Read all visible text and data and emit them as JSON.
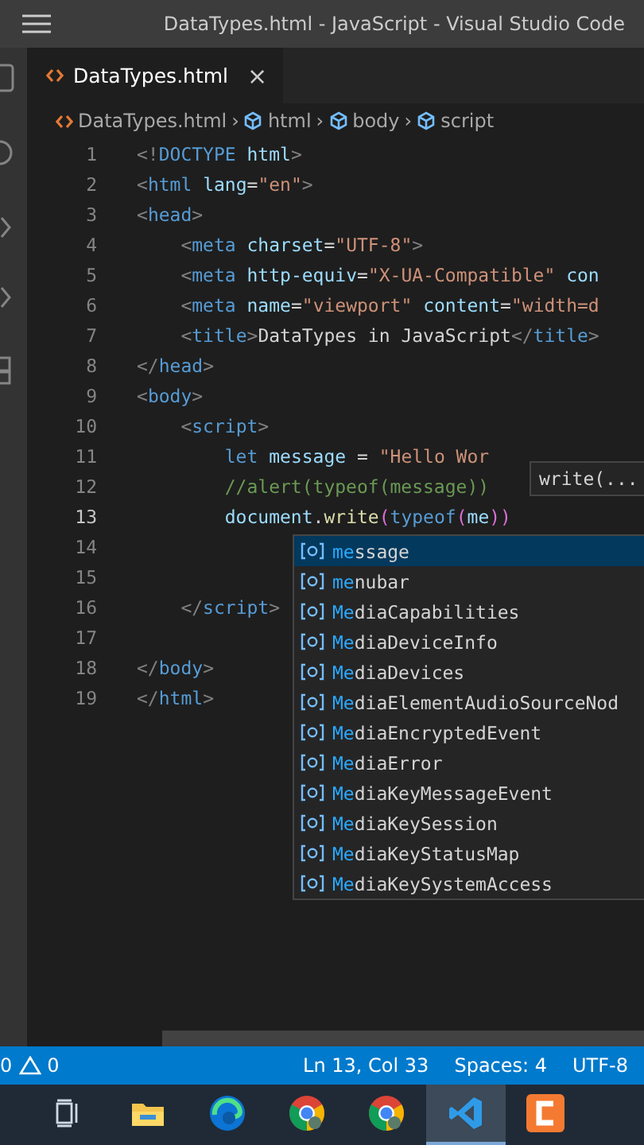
{
  "title_bar": {
    "title": "DataTypes.html - JavaScript - Visual Studio Code"
  },
  "tabs": [
    {
      "label": "DataTypes.html",
      "selected": true,
      "close": "×"
    }
  ],
  "breadcrumbs": [
    {
      "label": "DataTypes.html",
      "kind": "file"
    },
    {
      "separator": "›",
      "label": "html",
      "kind": "element"
    },
    {
      "separator": "›",
      "label": "body",
      "kind": "element"
    },
    {
      "separator": "›",
      "label": "script",
      "kind": "element"
    }
  ],
  "editor": {
    "lines": [
      {
        "number": "1",
        "current": false,
        "tokens": [
          {
            "kind": "punct",
            "text": "<!"
          },
          {
            "kind": "tag",
            "text": "DOCTYPE"
          },
          {
            "kind": "attr",
            "text": " html"
          },
          {
            "kind": "punct",
            "text": ">"
          }
        ]
      },
      {
        "number": "2",
        "current": false,
        "tokens": [
          {
            "kind": "punct",
            "text": "<"
          },
          {
            "kind": "tag",
            "text": "html"
          },
          {
            "kind": "attr",
            "text": " lang"
          },
          {
            "kind": "text",
            "text": "="
          },
          {
            "kind": "str",
            "text": "\"en\""
          },
          {
            "kind": "punct",
            "text": ">"
          }
        ]
      },
      {
        "number": "3",
        "current": false,
        "tokens": [
          {
            "kind": "punct",
            "text": "<"
          },
          {
            "kind": "tag",
            "text": "head"
          },
          {
            "kind": "punct",
            "text": ">"
          }
        ]
      },
      {
        "number": "4",
        "current": false,
        "tokens": [
          {
            "kind": "punct",
            "text": "    <"
          },
          {
            "kind": "tag",
            "text": "meta"
          },
          {
            "kind": "attr",
            "text": " charset"
          },
          {
            "kind": "text",
            "text": "="
          },
          {
            "kind": "str",
            "text": "\"UTF-8\""
          },
          {
            "kind": "punct",
            "text": ">"
          }
        ]
      },
      {
        "number": "5",
        "current": false,
        "tokens": [
          {
            "kind": "punct",
            "text": "    <"
          },
          {
            "kind": "tag",
            "text": "meta"
          },
          {
            "kind": "attr",
            "text": " http-equiv"
          },
          {
            "kind": "text",
            "text": "="
          },
          {
            "kind": "str",
            "text": "\"X-UA-Compatible\""
          },
          {
            "kind": "attr",
            "text": " con"
          }
        ]
      },
      {
        "number": "6",
        "current": false,
        "tokens": [
          {
            "kind": "punct",
            "text": "    <"
          },
          {
            "kind": "tag",
            "text": "meta"
          },
          {
            "kind": "attr",
            "text": " name"
          },
          {
            "kind": "text",
            "text": "="
          },
          {
            "kind": "str",
            "text": "\"viewport\""
          },
          {
            "kind": "attr",
            "text": " content"
          },
          {
            "kind": "text",
            "text": "="
          },
          {
            "kind": "str",
            "text": "\"width=d"
          }
        ]
      },
      {
        "number": "7",
        "current": false,
        "tokens": [
          {
            "kind": "punct",
            "text": "    <"
          },
          {
            "kind": "tag",
            "text": "title"
          },
          {
            "kind": "punct",
            "text": ">"
          },
          {
            "kind": "text",
            "text": "DataTypes in JavaScript"
          },
          {
            "kind": "punct",
            "text": "</"
          },
          {
            "kind": "tag",
            "text": "title"
          },
          {
            "kind": "punct",
            "text": ">"
          }
        ]
      },
      {
        "number": "8",
        "current": false,
        "tokens": [
          {
            "kind": "punct",
            "text": "</"
          },
          {
            "kind": "tag",
            "text": "head"
          },
          {
            "kind": "punct",
            "text": ">"
          }
        ]
      },
      {
        "number": "9",
        "current": false,
        "tokens": [
          {
            "kind": "punct",
            "text": "<"
          },
          {
            "kind": "tag",
            "text": "body"
          },
          {
            "kind": "punct",
            "text": ">"
          }
        ]
      },
      {
        "number": "10",
        "current": false,
        "tokens": [
          {
            "kind": "punct",
            "text": "    <"
          },
          {
            "kind": "tag",
            "text": "script"
          },
          {
            "kind": "punct",
            "text": ">"
          }
        ]
      },
      {
        "number": "11",
        "current": false,
        "tokens": [
          {
            "kind": "kw",
            "text": "        let"
          },
          {
            "kind": "var",
            "text": " message"
          },
          {
            "kind": "text",
            "text": " = "
          },
          {
            "kind": "str",
            "text": "\"Hello Wor"
          }
        ]
      },
      {
        "number": "12",
        "current": false,
        "tokens": [
          {
            "kind": "comment",
            "text": "        //alert(typeof(message))"
          }
        ]
      },
      {
        "number": "13",
        "current": true,
        "tokens": [
          {
            "kind": "var",
            "text": "        document"
          },
          {
            "kind": "text",
            "text": "."
          },
          {
            "kind": "fn",
            "text": "write"
          },
          {
            "kind": "paren",
            "text": "("
          },
          {
            "kind": "kw",
            "text": "typeof"
          },
          {
            "kind": "paren",
            "text": "("
          },
          {
            "kind": "var",
            "text": "me"
          },
          {
            "kind": "paren",
            "text": "))"
          }
        ]
      },
      {
        "number": "14",
        "current": false
      },
      {
        "number": "15",
        "current": false
      },
      {
        "number": "16",
        "current": false,
        "tokens": [
          {
            "kind": "punct",
            "text": "    </"
          },
          {
            "kind": "tag",
            "text": "script"
          },
          {
            "kind": "punct",
            "text": ">"
          }
        ]
      },
      {
        "number": "17",
        "current": false
      },
      {
        "number": "18",
        "current": false,
        "tokens": [
          {
            "kind": "punct",
            "text": "</"
          },
          {
            "kind": "tag",
            "text": "body"
          },
          {
            "kind": "punct",
            "text": ">"
          }
        ]
      },
      {
        "number": "19",
        "current": false,
        "tokens": [
          {
            "kind": "punct",
            "text": "</"
          },
          {
            "kind": "tag",
            "text": "html"
          },
          {
            "kind": "punct",
            "text": ">"
          }
        ]
      }
    ]
  },
  "hover": {
    "text": "write(..."
  },
  "suggestions": [
    {
      "match": "me",
      "rest": "ssage",
      "selected": true
    },
    {
      "match": "me",
      "rest": "nubar",
      "selected": false
    },
    {
      "match": "Me",
      "rest": "diaCapabilities",
      "selected": false
    },
    {
      "match": "Me",
      "rest": "diaDeviceInfo",
      "selected": false
    },
    {
      "match": "Me",
      "rest": "diaDevices",
      "selected": false
    },
    {
      "match": "Me",
      "rest": "diaElementAudioSourceNod",
      "selected": false
    },
    {
      "match": "Me",
      "rest": "diaEncryptedEvent",
      "selected": false
    },
    {
      "match": "Me",
      "rest": "diaError",
      "selected": false
    },
    {
      "match": "Me",
      "rest": "diaKeyMessageEvent",
      "selected": false
    },
    {
      "match": "Me",
      "rest": "diaKeySession",
      "selected": false
    },
    {
      "match": "Me",
      "rest": "diaKeyStatusMap",
      "selected": false
    },
    {
      "match": "Me",
      "rest": "diaKeySystemAccess",
      "selected": false
    }
  ],
  "status_bar": {
    "errors": "0",
    "warnings": "0",
    "items": [
      "Ln 13, Col 33",
      "Spaces: 4",
      "UTF-8"
    ]
  },
  "taskbar": [
    {
      "kind": "taskview",
      "selected": false
    },
    {
      "kind": "folder",
      "selected": false
    },
    {
      "kind": "edge",
      "selected": false
    },
    {
      "kind": "chrome",
      "selected": false
    },
    {
      "kind": "chrome",
      "selected": false
    },
    {
      "kind": "vscode",
      "selected": true
    },
    {
      "kind": "camtasia",
      "selected": false
    }
  ]
}
